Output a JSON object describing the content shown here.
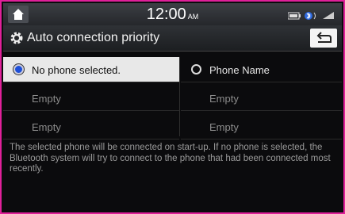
{
  "statusbar": {
    "time": "12:00",
    "ampm": "AM"
  },
  "header": {
    "title": "Auto connection priority"
  },
  "options": {
    "left_label": "No phone selected.",
    "right_label": "Phone Name"
  },
  "slots": {
    "left": [
      "Empty",
      "Empty"
    ],
    "right": [
      "Empty",
      "Empty"
    ]
  },
  "description": "The selected phone will be connected on start-up. If no phone is selected, the Bluetooth system will try to connect to the phone that had been connected most recently.",
  "colors": {
    "frame": "#e0209a",
    "radio_selected": "#1d4fd8"
  },
  "icons": [
    "home-icon",
    "gear-icon",
    "back-icon",
    "battery-icon",
    "bluetooth-audio-icon",
    "signal-icon"
  ]
}
